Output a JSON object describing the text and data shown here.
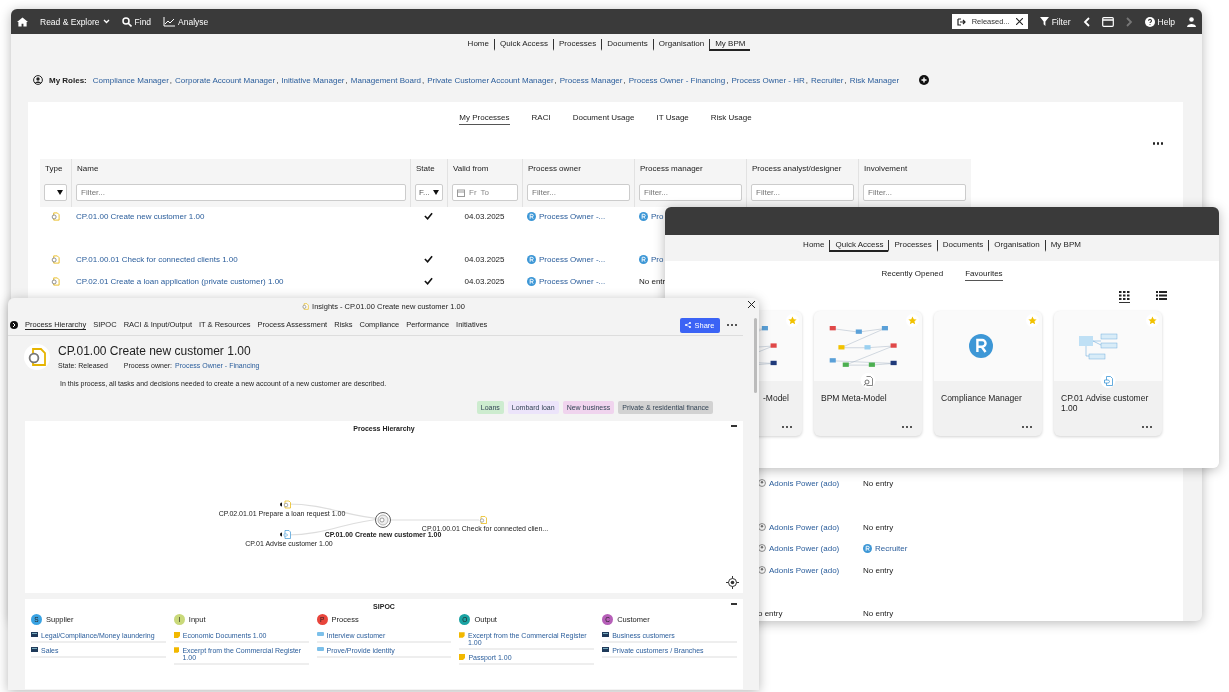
{
  "main_window": {
    "toolbar": {
      "left": [
        {
          "kind": "home"
        },
        {
          "kind": "menu",
          "label": "Read & Explore"
        },
        {
          "kind": "find",
          "label": "Find"
        },
        {
          "kind": "analyse",
          "label": "Analyse"
        }
      ],
      "filter_chip": {
        "label": "Released..."
      },
      "right": [
        {
          "kind": "filter",
          "label": "Filter"
        },
        {
          "kind": "back",
          "disabled": false
        },
        {
          "kind": "window",
          "disabled": false
        },
        {
          "kind": "forward",
          "disabled": true
        },
        {
          "kind": "help",
          "label": "Help"
        },
        {
          "kind": "user"
        }
      ]
    },
    "nav": [
      {
        "label": "Home",
        "selected": false
      },
      {
        "label": "Quick Access",
        "selected": false
      },
      {
        "label": "Processes",
        "selected": false
      },
      {
        "label": "Documents",
        "selected": false
      },
      {
        "label": "Organisation",
        "selected": false
      },
      {
        "label": "My BPM",
        "selected": true
      }
    ],
    "roles": {
      "label": "My Roles:",
      "items": [
        {
          "text": "Compliance Manager",
          "separator": ","
        },
        {
          "text": "Corporate Account Manager",
          "separator": ","
        },
        {
          "text": "Initiative Manager",
          "separator": ","
        },
        {
          "text": "Management Board",
          "separator": ","
        },
        {
          "text": "Private Customer Account Manager",
          "separator": ","
        },
        {
          "text": "Process Manager",
          "separator": ","
        },
        {
          "text": "Process Owner - Financing",
          "separator": ","
        },
        {
          "text": "Process Owner - HR",
          "separator": ","
        },
        {
          "text": "Recruiter",
          "separator": ","
        },
        {
          "text": "Risk Manager"
        }
      ]
    },
    "subtabs": [
      {
        "label": "My Processes",
        "selected": true
      },
      {
        "label": "RACI",
        "selected": false
      },
      {
        "label": "Document Usage",
        "selected": false
      },
      {
        "label": "IT Usage",
        "selected": false
      },
      {
        "label": "Risk Usage",
        "selected": false
      }
    ],
    "table": {
      "columns": [
        "Type",
        "Name",
        "State",
        "Valid from",
        "Process owner",
        "Process manager",
        "Process analyst/designer",
        "Involvement"
      ],
      "filters": [
        {
          "kind": "dropdown"
        },
        {
          "kind": "text",
          "placeholder": "Filter..."
        },
        {
          "kind": "dropdown",
          "value": "F..."
        },
        {
          "kind": "date",
          "placeholder": "Fr",
          "placeholder_2": "To"
        },
        {
          "kind": "text",
          "placeholder": "Filter..."
        },
        {
          "kind": "text",
          "placeholder": "Filter..."
        },
        {
          "kind": "text",
          "placeholder": "Filter..."
        },
        {
          "kind": "text",
          "placeholder": "Filter..."
        }
      ],
      "rows": [
        {
          "kind": "process",
          "name": "CP.01.00 Create new customer 1.00",
          "released": true,
          "valid_from": "04.03.2025",
          "owner": {
            "kind": "role",
            "text": "Process Owner -..."
          },
          "manager": {
            "kind": "role",
            "text": "Pro"
          }
        },
        {
          "kind": "process",
          "name": "CP.01.00.01 Check for connected clients 1.00",
          "released": true,
          "valid_from": "04.03.2025",
          "owner": {
            "kind": "role",
            "text": "Process Owner -..."
          },
          "manager": {
            "kind": "role",
            "text": "Pro"
          }
        },
        {
          "kind": "process",
          "name": "CP.02.01 Create a loan application (private customer) 1.00",
          "released": true,
          "valid_from": "04.03.2025",
          "owner": {
            "kind": "role",
            "text": "Process Owner -..."
          },
          "manager": {
            "kind": "text",
            "text": "No entr"
          }
        },
        {
          "analyst": {
            "kind": "person",
            "text": "Adonis Power (ado)"
          },
          "involvement": {
            "kind": "text",
            "text": "No entry"
          }
        },
        {
          "analyst": {
            "kind": "person",
            "text": "Adonis Power (ado)"
          },
          "involvement": {
            "kind": "text",
            "text": "No entry"
          }
        },
        {
          "analyst": {
            "kind": "person",
            "text": "Adonis Power (ado)"
          },
          "involvement": {
            "kind": "role",
            "text": "Recruiter"
          }
        },
        {
          "analyst": {
            "kind": "person",
            "text": "Adonis Power (ado)"
          },
          "involvement": {
            "kind": "text",
            "text": "No entry"
          }
        },
        {
          "analyst": {
            "kind": "text",
            "text": "o entry"
          },
          "involvement": {
            "kind": "text",
            "text": "No entry"
          }
        }
      ]
    }
  },
  "quick_access_window": {
    "nav": [
      {
        "label": "Home",
        "selected": false
      },
      {
        "label": "Quick Access",
        "selected": true
      },
      {
        "label": "Processes",
        "selected": false
      },
      {
        "label": "Documents",
        "selected": false
      },
      {
        "label": "Organisation",
        "selected": false
      },
      {
        "label": "My BPM",
        "selected": false
      }
    ],
    "subtabs": [
      {
        "label": "Recently Opened",
        "selected": false
      },
      {
        "label": "Favourites",
        "selected": true
      }
    ],
    "views": [
      {
        "kind": "grid",
        "selected": true
      },
      {
        "kind": "list",
        "selected": false
      }
    ],
    "cards": [
      {
        "kind": "model",
        "title": "-Model",
        "favourite": true
      },
      {
        "kind": "model",
        "title": "BPM Meta-Model",
        "favourite": true
      },
      {
        "kind": "role",
        "title": "Compliance Manager",
        "favourite": true
      },
      {
        "kind": "process",
        "title": "CP.01 Advise customer 1.00",
        "favourite": true
      }
    ]
  },
  "insights_window": {
    "title": "Insights - CP.01.00 Create new customer 1.00",
    "tabs": [
      {
        "label": "Process Hierarchy",
        "selected": true
      },
      {
        "label": "SIPOC",
        "selected": false
      },
      {
        "label": "RACI & Input/Output",
        "selected": false
      },
      {
        "label": "IT & Resources",
        "selected": false
      },
      {
        "label": "Process Assessment",
        "selected": false
      },
      {
        "label": "Risks",
        "selected": false
      },
      {
        "label": "Compliance",
        "selected": false
      },
      {
        "label": "Performance",
        "selected": false
      },
      {
        "label": "Initiatives",
        "selected": false
      }
    ],
    "share": "Share",
    "heading": "CP.01.00 Create new customer 1.00",
    "state": "State: Released",
    "owner_label": "Process owner:",
    "owner": "Process Owner - Financing",
    "description": "In this process, all tasks and decisions needed to create a new account of a new customer are described.",
    "tags": [
      {
        "label": "Loans",
        "color": "#cdeccf"
      },
      {
        "label": "Lombard loan",
        "color": "#ece4fa"
      },
      {
        "label": "New business",
        "color": "#f0d4ee"
      },
      {
        "label": "Private & residential finance",
        "color": "#d2d2d2"
      }
    ],
    "hierarchy": {
      "title": "Process Hierarchy",
      "nodes": [
        {
          "kind": "main",
          "label": "CP.01.00 Create new customer 1.00"
        },
        {
          "kind": "parent",
          "label": "CP.02.01.01 Prepare a loan request 1.00"
        },
        {
          "kind": "parent_doc",
          "label": "CP.01 Advise customer 1.00"
        },
        {
          "kind": "child",
          "label": "CP.01.00.01 Check for connected clien..."
        }
      ]
    },
    "sipoc": {
      "title": "SIPOC",
      "columns": [
        {
          "letter": "S",
          "title": "Supplier",
          "color": "#3aa3e3",
          "items": [
            {
              "kind": "org",
              "text": "Legal/Compliance/Money laundering"
            },
            {
              "kind": "org",
              "text": "Sales"
            }
          ]
        },
        {
          "letter": "I",
          "title": "Input",
          "color": "#c9d97a",
          "items": [
            {
              "kind": "doc",
              "text": "Economic Documents 1.00"
            },
            {
              "kind": "doc",
              "text": "Excerpt from the Commercial Register 1.00"
            }
          ]
        },
        {
          "letter": "P",
          "title": "Process",
          "color": "#e8453c",
          "items": [
            {
              "kind": "task",
              "text": "Interview customer"
            },
            {
              "kind": "task",
              "text": "Prove/Provide identity"
            }
          ]
        },
        {
          "letter": "O",
          "title": "Output",
          "color": "#1aa3a3",
          "items": [
            {
              "kind": "doc",
              "text": "Excerpt from the Commercial Register 1.00"
            },
            {
              "kind": "doc",
              "text": "Passport 1.00"
            }
          ]
        },
        {
          "letter": "C",
          "title": "Customer",
          "color": "#b65fb8",
          "items": [
            {
              "kind": "org",
              "text": "Business customers"
            },
            {
              "kind": "org",
              "text": "Private customers / Branches"
            }
          ]
        }
      ]
    }
  }
}
